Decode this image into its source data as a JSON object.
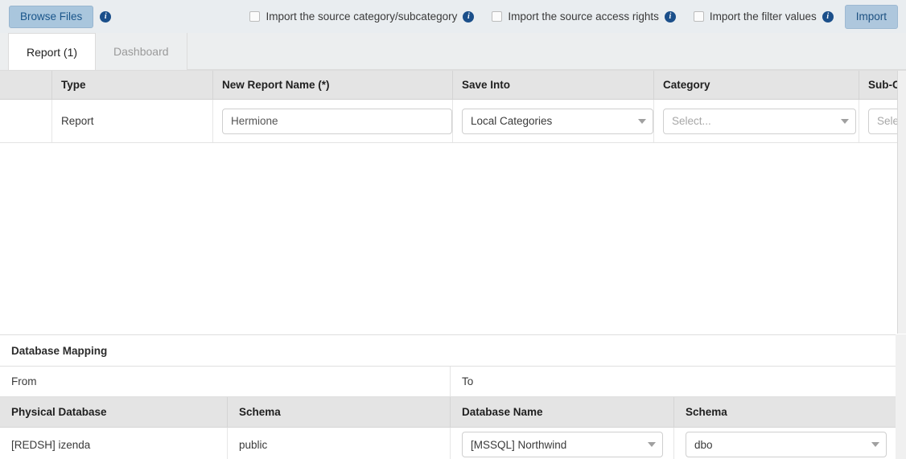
{
  "toolbar": {
    "browse_button": "Browse Files",
    "browse_info_icon": "info-icon",
    "checkboxes": [
      {
        "label": "Import the source category/subcategory",
        "checked": false,
        "info_icon": "info-icon"
      },
      {
        "label": "Import the source access rights",
        "checked": false,
        "info_icon": "info-icon"
      },
      {
        "label": "Import the filter values",
        "checked": false,
        "info_icon": "info-icon"
      }
    ],
    "import_button": "Import",
    "colors": {
      "toolbar_bg": "#e9edf0",
      "button_bg": "#a9c6dd",
      "button_text": "#19558a",
      "info_icon_bg": "#1b4f8a"
    }
  },
  "tabs": [
    {
      "label": "Report (1)",
      "active": true
    },
    {
      "label": "Dashboard",
      "active": false
    }
  ],
  "report_grid": {
    "columns": [
      "",
      "Type",
      "New Report Name (*)",
      "Save Into",
      "Category",
      "Sub-Ca"
    ],
    "rows": [
      {
        "type": "Report",
        "new_report_name": "Hermione",
        "save_into": "Local Categories",
        "category": "Select...",
        "category_is_placeholder": true,
        "subcategory": "Select...",
        "subcategory_is_placeholder": true
      }
    ]
  },
  "database_mapping": {
    "title": "Database Mapping",
    "from_label": "From",
    "to_label": "To",
    "columns": [
      "Physical Database",
      "Schema",
      "Database Name",
      "Schema"
    ],
    "rows": [
      {
        "physical_database": "[REDSH] izenda",
        "source_schema": "public",
        "database_name": "[MSSQL] Northwind",
        "target_schema": "dbo"
      }
    ]
  }
}
